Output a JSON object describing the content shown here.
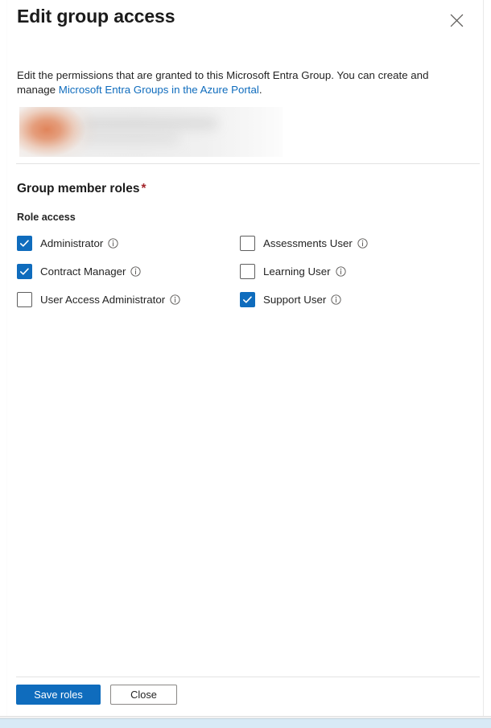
{
  "header": {
    "title": "Edit group access",
    "close_icon": "close-icon"
  },
  "description": {
    "text_before": "Edit the permissions that are granted to this Microsoft Entra Group. You can create and manage ",
    "link_text": "Microsoft Entra Groups in the Azure Portal",
    "text_after": ".",
    "link_color": "#0f6cbd"
  },
  "group_identity": {
    "redacted": true,
    "note": "blurred group name and avatar"
  },
  "roles": {
    "section_title": "Group member roles",
    "required_marker": "*",
    "required_color": "#a4262c",
    "sub_label": "Role access",
    "accent_color": "#0f6cbd",
    "columns": [
      {
        "items": [
          {
            "label": "Administrator",
            "checked": true,
            "info_icon": "info-icon"
          },
          {
            "label": "Contract Manager",
            "checked": true,
            "info_icon": "info-icon"
          },
          {
            "label": "User Access Administrator",
            "checked": false,
            "info_icon": "info-icon"
          }
        ]
      },
      {
        "items": [
          {
            "label": "Assessments User",
            "checked": false,
            "info_icon": "info-icon"
          },
          {
            "label": "Learning User",
            "checked": false,
            "info_icon": "info-icon"
          },
          {
            "label": "Support User",
            "checked": true,
            "info_icon": "info-icon"
          }
        ]
      }
    ]
  },
  "footer": {
    "save_label": "Save roles",
    "close_label": "Close"
  }
}
